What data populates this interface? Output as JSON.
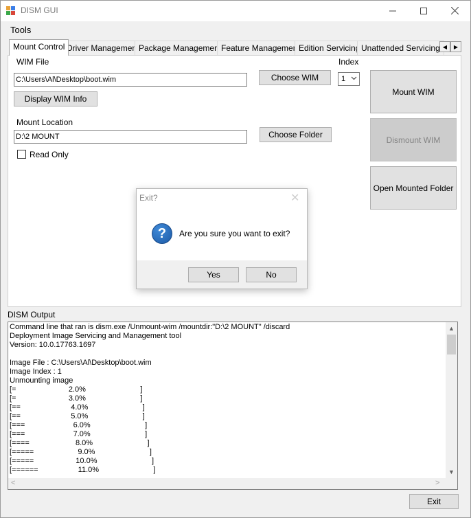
{
  "window": {
    "title": "DISM GUI",
    "min_icon": "—",
    "max_icon": "☐",
    "close_icon": "✕"
  },
  "menu": {
    "tools": "Tools"
  },
  "tabs": [
    "Mount Control",
    "Driver Management",
    "Package Management",
    "Feature Management",
    "Edition Servicing",
    "Unattended Servicing"
  ],
  "tab_scroll": {
    "left": "◀",
    "right": "▶"
  },
  "mount": {
    "wim_file_label": "WIM File",
    "wim_file_value": "C:\\Users\\Al\\Desktop\\boot.wim",
    "choose_wim": "Choose WIM",
    "index_label": "Index",
    "index_value": "1",
    "display_wim_info": "Display WIM Info",
    "mount_location_label": "Mount Location",
    "mount_location_value": "D:\\2 MOUNT",
    "choose_folder": "Choose Folder",
    "read_only_label": "Read Only",
    "mount_wim": "Mount WIM",
    "dismount_wim": "Dismount WIM",
    "open_mounted_folder": "Open Mounted Folder"
  },
  "dialog": {
    "title": "Exit?",
    "close_glyph": "✕",
    "icon_glyph": "?",
    "message": "Are you sure you want to exit?",
    "yes": "Yes",
    "no": "No"
  },
  "output": {
    "label": "DISM Output",
    "lines": [
      "Command line that ran is dism.exe /Unmount-wim /mountdir:\"D:\\2 MOUNT\" /discard",
      "Deployment Image Servicing and Management tool",
      "Version: 10.0.17763.1697",
      "",
      "Image File : C:\\Users\\Al\\Desktop\\boot.wim",
      "Image Index : 1",
      "Unmounting image",
      "[=                         2.0%                          ]",
      "[=                         3.0%                          ]",
      "[==                        4.0%                          ]",
      "[==                        5.0%                          ]",
      "[===                       6.0%                          ]",
      "[===                       7.0%                          ]",
      "[====                      8.0%                          ]",
      "[=====                     9.0%                          ]",
      "[=====                    10.0%                          ]",
      "[======                   11.0%                          ]"
    ],
    "scroll_up": "▲",
    "scroll_down": "▼",
    "scroll_left": "<",
    "scroll_right": ">"
  },
  "exit_button": "Exit"
}
